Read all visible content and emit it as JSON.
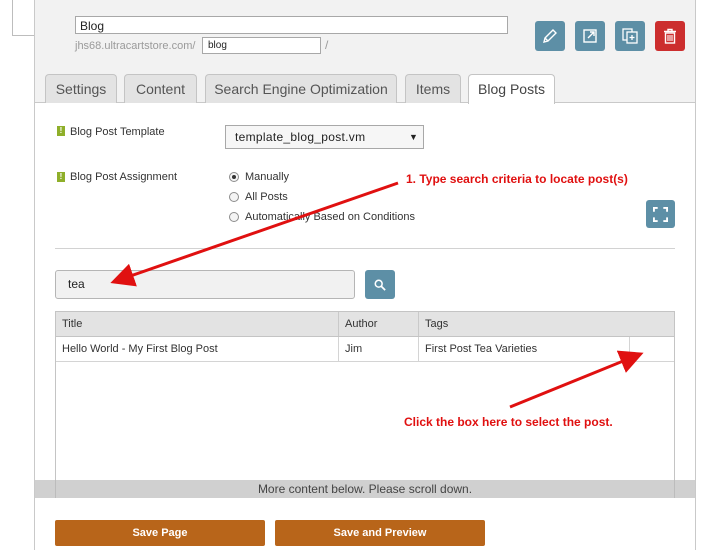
{
  "header": {
    "title_value": "Blog",
    "url_prefix": "jhs68.ultracartstore.com/",
    "slug_value": "blog",
    "url_suffix": "/"
  },
  "toolbar": {
    "edit_icon": "pencil-icon",
    "open_icon": "external-link-icon",
    "copy_icon": "duplicate-icon",
    "delete_icon": "trash-icon",
    "accent_color": "#5d8fa6",
    "danger_color": "#cc2e2e"
  },
  "tabs": [
    {
      "label": "Settings"
    },
    {
      "label": "Content"
    },
    {
      "label": "Search Engine Optimization"
    },
    {
      "label": "Items"
    },
    {
      "label": "Blog Posts",
      "active": true
    }
  ],
  "form": {
    "template_label": "Blog Post Template",
    "template_value": "template_blog_post.vm",
    "assignment_label": "Blog Post Assignment",
    "assignment_options": [
      "Manually",
      "All Posts",
      "Automatically Based on Conditions"
    ],
    "assignment_selected": "Manually"
  },
  "search": {
    "value": "tea",
    "button_icon": "search-icon"
  },
  "table": {
    "columns": [
      "Title",
      "Author",
      "Tags"
    ],
    "rows": [
      {
        "title": "Hello World - My First Blog Post",
        "author": "Jim",
        "tags": "First Post Tea Varieties"
      }
    ]
  },
  "scroll_banner": "More content below. Please scroll down.",
  "actions": {
    "save_label": "Save Page",
    "preview_label": "Save and Preview",
    "button_color": "#b8651a"
  },
  "annotations": {
    "search_note": "1. Type search criteria to locate post(s)",
    "select_note": "Click the box here to select the post.",
    "color": "#e01010"
  }
}
